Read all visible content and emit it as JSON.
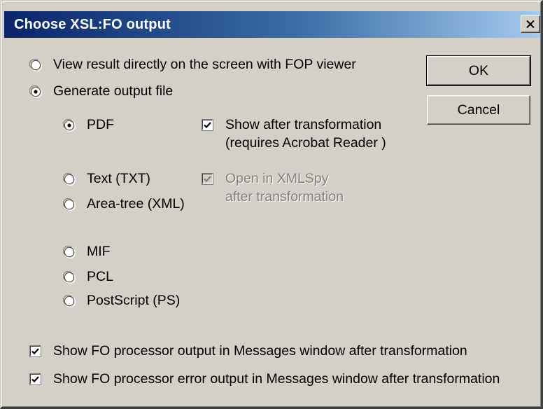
{
  "window": {
    "title": "Choose XSL:FO output"
  },
  "buttons": {
    "ok": "OK",
    "cancel": "Cancel"
  },
  "mode": {
    "view_fop": {
      "label": "View result directly on the screen with FOP viewer",
      "selected": false
    },
    "generate_file": {
      "label": "Generate output file",
      "selected": true
    }
  },
  "formats": {
    "pdf": {
      "label": "PDF",
      "selected": true
    },
    "txt": {
      "label": "Text (TXT)",
      "selected": false
    },
    "area_tree": {
      "label": "Area-tree (XML)",
      "selected": false
    },
    "mif": {
      "label": "MIF",
      "selected": false
    },
    "pcl": {
      "label": "PCL",
      "selected": false
    },
    "ps": {
      "label": "PostScript (PS)",
      "selected": false
    }
  },
  "pdf_options": {
    "show_after": {
      "line1": "Show after transformation",
      "line2": "(requires Acrobat Reader )",
      "checked": true,
      "enabled": true
    }
  },
  "xml_options": {
    "open_xmlspy": {
      "line1": "Open in XMLSpy",
      "line2": "after transformation",
      "checked": true,
      "enabled": false
    }
  },
  "messages": {
    "show_output": {
      "label": "Show FO processor output in Messages window after transformation",
      "checked": true
    },
    "show_errors": {
      "label": "Show FO processor error output in Messages window after transformation",
      "checked": true
    }
  }
}
